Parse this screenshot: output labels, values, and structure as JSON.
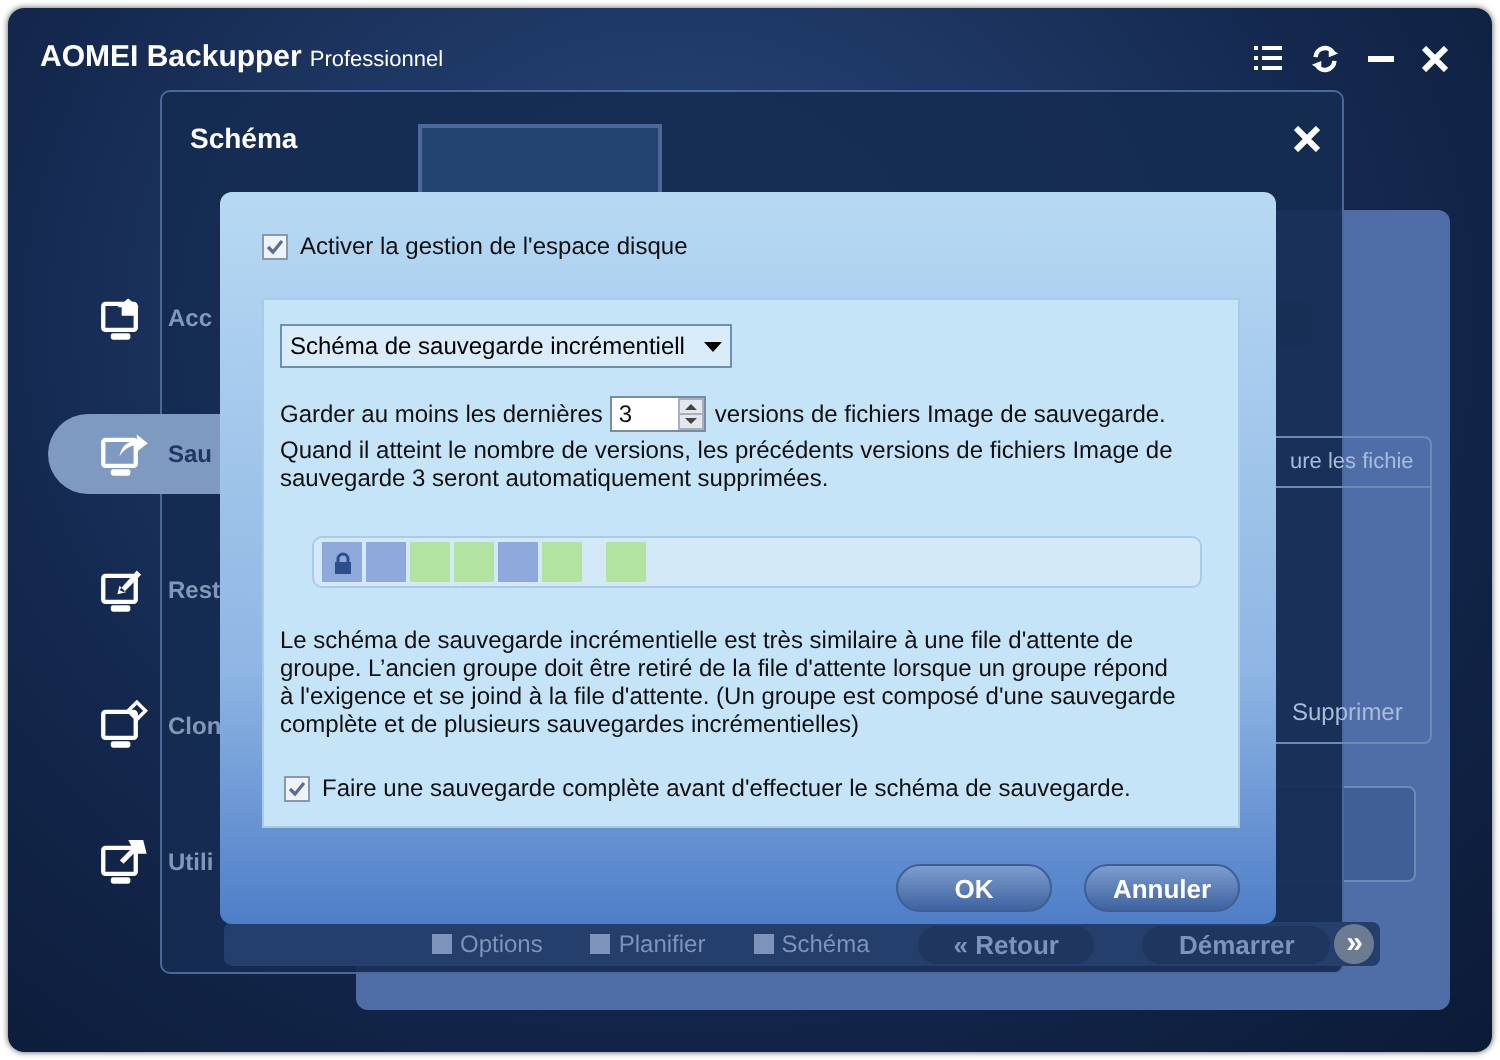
{
  "app": {
    "title": "AOMEI Backupper",
    "edition": "Professionnel"
  },
  "sidebar": {
    "items": [
      {
        "label": "Acc",
        "selected": false
      },
      {
        "label": "Sau",
        "selected": true
      },
      {
        "label": "Rest",
        "selected": false
      },
      {
        "label": "Clon",
        "selected": false
      },
      {
        "label": "Utili",
        "selected": false
      }
    ]
  },
  "background_panel": {
    "list_header": "ure les fichie",
    "remove_button": "Supprimer",
    "bottom_bar": [
      {
        "label": "Options",
        "kind": "option"
      },
      {
        "label": "Planifier",
        "kind": "option"
      },
      {
        "label": "Schéma",
        "kind": "option"
      },
      {
        "label": "« Retour",
        "kind": "button"
      },
      {
        "label": "Démarrer",
        "kind": "button"
      },
      {
        "label": "»",
        "kind": "round"
      }
    ]
  },
  "scheme_dialog": {
    "title": "Schéma"
  },
  "settings": {
    "enable_space_management": {
      "label": "Activer la gestion de l'espace disque",
      "checked": true
    },
    "scheme_dropdown": {
      "value": "Schéma de sauvegarde incrémentiell"
    },
    "keep_prefix": "Garder au moins les dernières",
    "keep_value": "3",
    "keep_suffix": "versions de fichiers Image de sauvegarde.",
    "keep_note": "Quand il atteint le nombre de versions, les précédents versions de fichiers Image de sauvegarde 3 seront automatiquement supprimées.",
    "blocks": [
      {
        "kind": "locked",
        "color": "#8fa9dc"
      },
      {
        "kind": "block",
        "color": "#8fa9dc"
      },
      {
        "kind": "block",
        "color": "#b3e3a0"
      },
      {
        "kind": "block",
        "color": "#b3e3a0"
      },
      {
        "kind": "block",
        "color": "#8fa9dc"
      },
      {
        "kind": "block",
        "color": "#b3e3a0"
      },
      {
        "kind": "gap"
      },
      {
        "kind": "block",
        "color": "#b3e3a0"
      }
    ],
    "description": "Le schéma de sauvegarde incrémentielle est très similaire à une file d'attente de groupe. L’ancien groupe doit être retiré de la file d'attente lorsque un groupe répond à l'exigence et se joind à la file d'attente. (Un groupe est composé d'une sauvegarde complète et de plusieurs sauvegardes incrémentielles)",
    "full_first": {
      "label": "Faire une sauvegarde complète avant d'effectuer le schéma de sauvegarde.",
      "checked": true
    }
  },
  "buttons": [
    {
      "label": "OK"
    },
    {
      "label": "Annuler"
    }
  ]
}
